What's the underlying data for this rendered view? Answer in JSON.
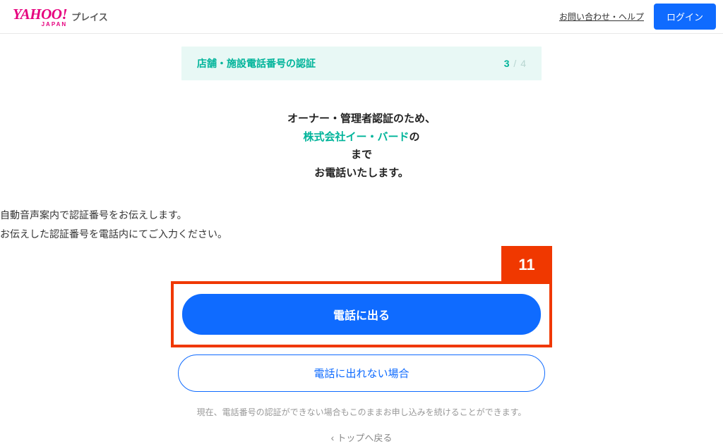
{
  "header": {
    "logo_main": "YAHOO!",
    "logo_sub": "JAPAN",
    "service_name": "プレイス",
    "help_link": "お問い合わせ・ヘルプ",
    "login_label": "ログイン"
  },
  "step": {
    "title": "店舗・施設電話番号の認証",
    "current": "3",
    "divider": "/",
    "total": "4"
  },
  "heading": {
    "line1": "オーナー・管理者認証のため、",
    "company": "株式会社イー・バード",
    "line2_suffix": "の",
    "line3_suffix": "まで",
    "line4": "お電話いたします。"
  },
  "description": {
    "line1": "自動音声案内で認証番号をお伝えします。",
    "line2": "お伝えした認証番号を電話内にてご入力ください。"
  },
  "highlight": {
    "label": "11"
  },
  "buttons": {
    "primary": "電話に出る",
    "secondary": "電話に出れない場合"
  },
  "note": "現在、電話番号の認証ができない場合もこのままお申し込みを続けることができます。",
  "back": "トップへ戻る"
}
